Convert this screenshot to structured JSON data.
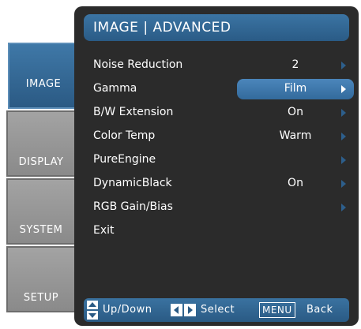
{
  "title": "IMAGE | ADVANCED",
  "tabs": [
    {
      "label": "IMAGE",
      "active": true
    },
    {
      "label": "DISPLAY",
      "active": false
    },
    {
      "label": "SYSTEM",
      "active": false
    },
    {
      "label": "SETUP",
      "active": false
    }
  ],
  "menu": [
    {
      "label": "Noise Reduction",
      "value": "2",
      "has_arrow": true,
      "selected": false
    },
    {
      "label": "Gamma",
      "value": "Film",
      "has_arrow": true,
      "selected": true
    },
    {
      "label": "B/W Extension",
      "value": "On",
      "has_arrow": true,
      "selected": false
    },
    {
      "label": "Color Temp",
      "value": "Warm",
      "has_arrow": true,
      "selected": false
    },
    {
      "label": "PureEngine",
      "value": "",
      "has_arrow": true,
      "selected": false
    },
    {
      "label": "DynamicBlack",
      "value": "On",
      "has_arrow": true,
      "selected": false
    },
    {
      "label": "RGB Gain/Bias",
      "value": "",
      "has_arrow": true,
      "selected": false
    },
    {
      "label": "Exit",
      "value": "",
      "has_arrow": false,
      "selected": false
    }
  ],
  "help": {
    "updown_icon": "updown-arrows-icon",
    "updown_label": "Up/Down",
    "select_icon": "left-right-arrows-icon",
    "select_label": "Select",
    "menu_key": "MENU",
    "back_label": "Back"
  },
  "colors": {
    "accent": "#2f6694",
    "panel_bg": "#2b2b2b",
    "tab_inactive": "#969696"
  }
}
